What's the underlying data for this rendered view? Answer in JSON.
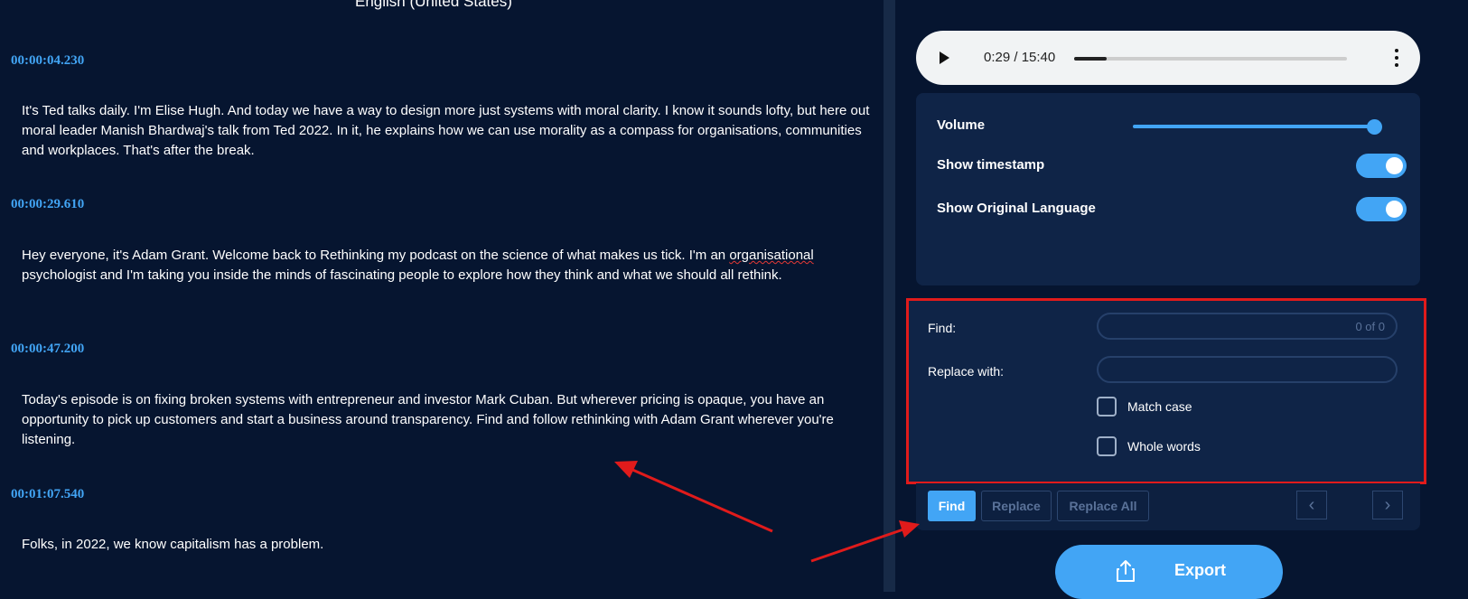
{
  "transcript": {
    "language_label": "English (United States)",
    "segments": [
      {
        "timestamp": "00:00:04.230",
        "text": "It's Ted talks daily. I'm Elise Hugh. And today we have a way to design more just systems with moral clarity. I know it sounds lofty, but here out moral leader Manish Bhardwaj's talk from Ted 2022. In it, he explains how we can use morality as a compass for organisations, communities and workplaces. That's after the break."
      },
      {
        "timestamp": "00:00:29.610",
        "text_before": "Hey everyone, it's Adam Grant. Welcome back to Rethinking my podcast on the science of what makes us tick. I'm an ",
        "flagged_word": "organisational",
        "text_after": " psychologist and I'm taking you inside the minds of fascinating people to explore how they think and what we should all rethink."
      },
      {
        "timestamp": "00:00:47.200",
        "text": "Today's episode is on fixing broken systems with entrepreneur and investor Mark Cuban. But wherever pricing is opaque, you have an opportunity to pick up customers and start a business around transparency. Find and follow rethinking with Adam Grant wherever you're listening."
      },
      {
        "timestamp": "00:01:07.540",
        "text": "Folks, in 2022, we know capitalism has a problem."
      }
    ]
  },
  "player": {
    "time_display": "0:29 / 15:40",
    "progress_fraction": 0.12,
    "buffered_fraction": 0.12,
    "icons": {
      "play": "play-icon",
      "more": "more-vert-icon"
    }
  },
  "settings": {
    "volume_label": "Volume",
    "volume_fraction": 0.97,
    "show_timestamp_label": "Show timestamp",
    "show_timestamp_on": true,
    "show_original_label": "Show Original Language",
    "show_original_on": true
  },
  "find_replace": {
    "find_label": "Find:",
    "find_value": "",
    "find_count": "0 of 0",
    "replace_label": "Replace with:",
    "replace_value": "",
    "match_case_label": "Match case",
    "match_case_checked": false,
    "whole_words_label": "Whole words",
    "whole_words_checked": false
  },
  "buttons": {
    "find": "Find",
    "replace": "Replace",
    "replace_all": "Replace All",
    "prev_icon": "chevron-left-icon",
    "next_icon": "chevron-right-icon",
    "export": "Export",
    "export_icon": "share-icon"
  },
  "colors": {
    "background": "#061530",
    "panel": "#0f2447",
    "accent": "#42a5f5",
    "highlight_border": "#e01b1b",
    "annotation_arrow": "#e01b1b"
  }
}
